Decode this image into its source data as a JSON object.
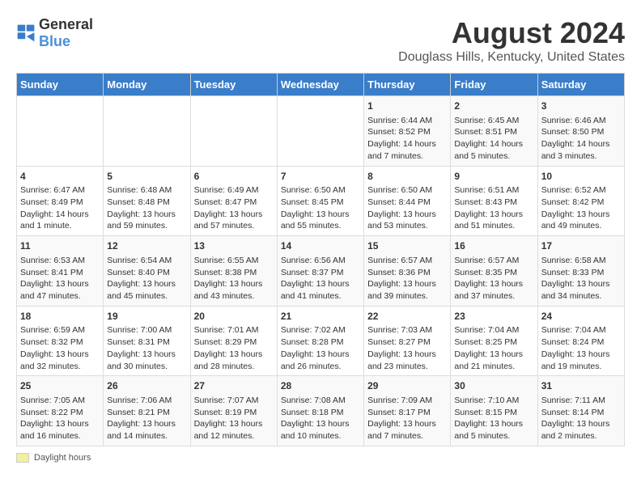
{
  "header": {
    "logo_general": "General",
    "logo_blue": "Blue",
    "title": "August 2024",
    "subtitle": "Douglass Hills, Kentucky, United States"
  },
  "calendar": {
    "days_of_week": [
      "Sunday",
      "Monday",
      "Tuesday",
      "Wednesday",
      "Thursday",
      "Friday",
      "Saturday"
    ],
    "weeks": [
      [
        {
          "day": "",
          "text": ""
        },
        {
          "day": "",
          "text": ""
        },
        {
          "day": "",
          "text": ""
        },
        {
          "day": "",
          "text": ""
        },
        {
          "day": "1",
          "text": "Sunrise: 6:44 AM\nSunset: 8:52 PM\nDaylight: 14 hours and 7 minutes."
        },
        {
          "day": "2",
          "text": "Sunrise: 6:45 AM\nSunset: 8:51 PM\nDaylight: 14 hours and 5 minutes."
        },
        {
          "day": "3",
          "text": "Sunrise: 6:46 AM\nSunset: 8:50 PM\nDaylight: 14 hours and 3 minutes."
        }
      ],
      [
        {
          "day": "4",
          "text": "Sunrise: 6:47 AM\nSunset: 8:49 PM\nDaylight: 14 hours and 1 minute."
        },
        {
          "day": "5",
          "text": "Sunrise: 6:48 AM\nSunset: 8:48 PM\nDaylight: 13 hours and 59 minutes."
        },
        {
          "day": "6",
          "text": "Sunrise: 6:49 AM\nSunset: 8:47 PM\nDaylight: 13 hours and 57 minutes."
        },
        {
          "day": "7",
          "text": "Sunrise: 6:50 AM\nSunset: 8:45 PM\nDaylight: 13 hours and 55 minutes."
        },
        {
          "day": "8",
          "text": "Sunrise: 6:50 AM\nSunset: 8:44 PM\nDaylight: 13 hours and 53 minutes."
        },
        {
          "day": "9",
          "text": "Sunrise: 6:51 AM\nSunset: 8:43 PM\nDaylight: 13 hours and 51 minutes."
        },
        {
          "day": "10",
          "text": "Sunrise: 6:52 AM\nSunset: 8:42 PM\nDaylight: 13 hours and 49 minutes."
        }
      ],
      [
        {
          "day": "11",
          "text": "Sunrise: 6:53 AM\nSunset: 8:41 PM\nDaylight: 13 hours and 47 minutes."
        },
        {
          "day": "12",
          "text": "Sunrise: 6:54 AM\nSunset: 8:40 PM\nDaylight: 13 hours and 45 minutes."
        },
        {
          "day": "13",
          "text": "Sunrise: 6:55 AM\nSunset: 8:38 PM\nDaylight: 13 hours and 43 minutes."
        },
        {
          "day": "14",
          "text": "Sunrise: 6:56 AM\nSunset: 8:37 PM\nDaylight: 13 hours and 41 minutes."
        },
        {
          "day": "15",
          "text": "Sunrise: 6:57 AM\nSunset: 8:36 PM\nDaylight: 13 hours and 39 minutes."
        },
        {
          "day": "16",
          "text": "Sunrise: 6:57 AM\nSunset: 8:35 PM\nDaylight: 13 hours and 37 minutes."
        },
        {
          "day": "17",
          "text": "Sunrise: 6:58 AM\nSunset: 8:33 PM\nDaylight: 13 hours and 34 minutes."
        }
      ],
      [
        {
          "day": "18",
          "text": "Sunrise: 6:59 AM\nSunset: 8:32 PM\nDaylight: 13 hours and 32 minutes."
        },
        {
          "day": "19",
          "text": "Sunrise: 7:00 AM\nSunset: 8:31 PM\nDaylight: 13 hours and 30 minutes."
        },
        {
          "day": "20",
          "text": "Sunrise: 7:01 AM\nSunset: 8:29 PM\nDaylight: 13 hours and 28 minutes."
        },
        {
          "day": "21",
          "text": "Sunrise: 7:02 AM\nSunset: 8:28 PM\nDaylight: 13 hours and 26 minutes."
        },
        {
          "day": "22",
          "text": "Sunrise: 7:03 AM\nSunset: 8:27 PM\nDaylight: 13 hours and 23 minutes."
        },
        {
          "day": "23",
          "text": "Sunrise: 7:04 AM\nSunset: 8:25 PM\nDaylight: 13 hours and 21 minutes."
        },
        {
          "day": "24",
          "text": "Sunrise: 7:04 AM\nSunset: 8:24 PM\nDaylight: 13 hours and 19 minutes."
        }
      ],
      [
        {
          "day": "25",
          "text": "Sunrise: 7:05 AM\nSunset: 8:22 PM\nDaylight: 13 hours and 16 minutes."
        },
        {
          "day": "26",
          "text": "Sunrise: 7:06 AM\nSunset: 8:21 PM\nDaylight: 13 hours and 14 minutes."
        },
        {
          "day": "27",
          "text": "Sunrise: 7:07 AM\nSunset: 8:19 PM\nDaylight: 13 hours and 12 minutes."
        },
        {
          "day": "28",
          "text": "Sunrise: 7:08 AM\nSunset: 8:18 PM\nDaylight: 13 hours and 10 minutes."
        },
        {
          "day": "29",
          "text": "Sunrise: 7:09 AM\nSunset: 8:17 PM\nDaylight: 13 hours and 7 minutes."
        },
        {
          "day": "30",
          "text": "Sunrise: 7:10 AM\nSunset: 8:15 PM\nDaylight: 13 hours and 5 minutes."
        },
        {
          "day": "31",
          "text": "Sunrise: 7:11 AM\nSunset: 8:14 PM\nDaylight: 13 hours and 2 minutes."
        }
      ]
    ]
  },
  "legend": {
    "label": "Daylight hours"
  }
}
